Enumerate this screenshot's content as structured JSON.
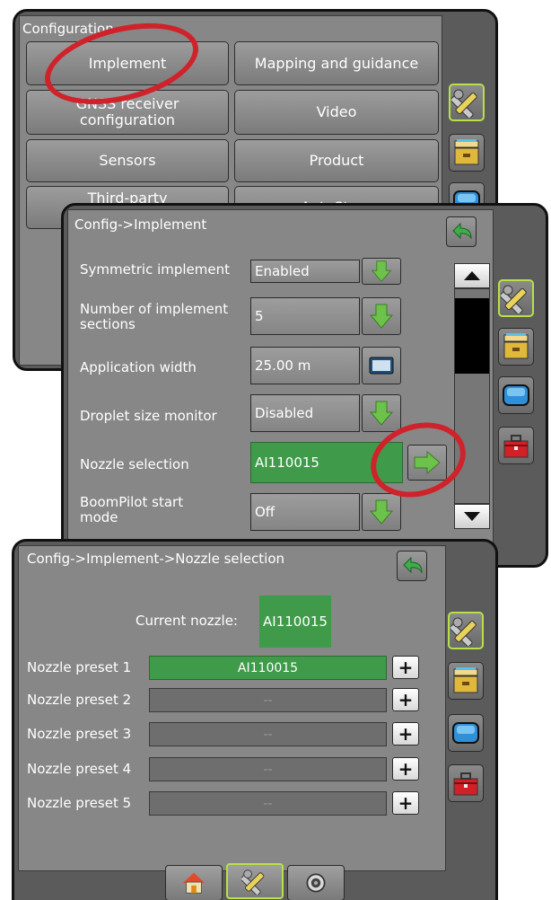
{
  "panel1": {
    "title": "Configuration",
    "buttons": [
      "Implement",
      "Mapping and guidance",
      "GNSS receiver configuration",
      "Video",
      "Sensors",
      "Product",
      "Third-party",
      "AutoSteer"
    ]
  },
  "panel2": {
    "title": "Config->Implement",
    "rows": [
      {
        "label": "Symmetric implement",
        "value": "Enabled",
        "control": "down-arrow"
      },
      {
        "label": "Number of implement sections",
        "value": "5",
        "control": "down-arrow"
      },
      {
        "label": "Application width",
        "value": "25.00 m",
        "control": "keyboard"
      },
      {
        "label": "Droplet size monitor",
        "value": "Disabled",
        "control": "down-arrow"
      },
      {
        "label": "Nozzle selection",
        "value": "AI110015",
        "control": "right-arrow"
      },
      {
        "label": "BoomPilot start mode",
        "value": "Off",
        "control": "down-arrow"
      }
    ]
  },
  "panel3": {
    "title": "Config->Implement->Nozzle selection",
    "current_label": "Current nozzle:",
    "current_value": "AI110015",
    "presets": [
      {
        "label": "Nozzle preset 1",
        "value": "AI110015"
      },
      {
        "label": "Nozzle preset 2",
        "value": "--"
      },
      {
        "label": "Nozzle preset 3",
        "value": "--"
      },
      {
        "label": "Nozzle preset 4",
        "value": "--"
      },
      {
        "label": "Nozzle preset 5",
        "value": "--"
      }
    ],
    "plus_label": "+"
  },
  "colors": {
    "accent_green": "#3f9b4a",
    "highlight_ring": "#d0222a",
    "active_border": "#b8e04a"
  },
  "icons": [
    "tools-icon",
    "storage-icon",
    "display-icon",
    "toolbox-icon",
    "back-icon",
    "home-icon",
    "camera-icon"
  ]
}
